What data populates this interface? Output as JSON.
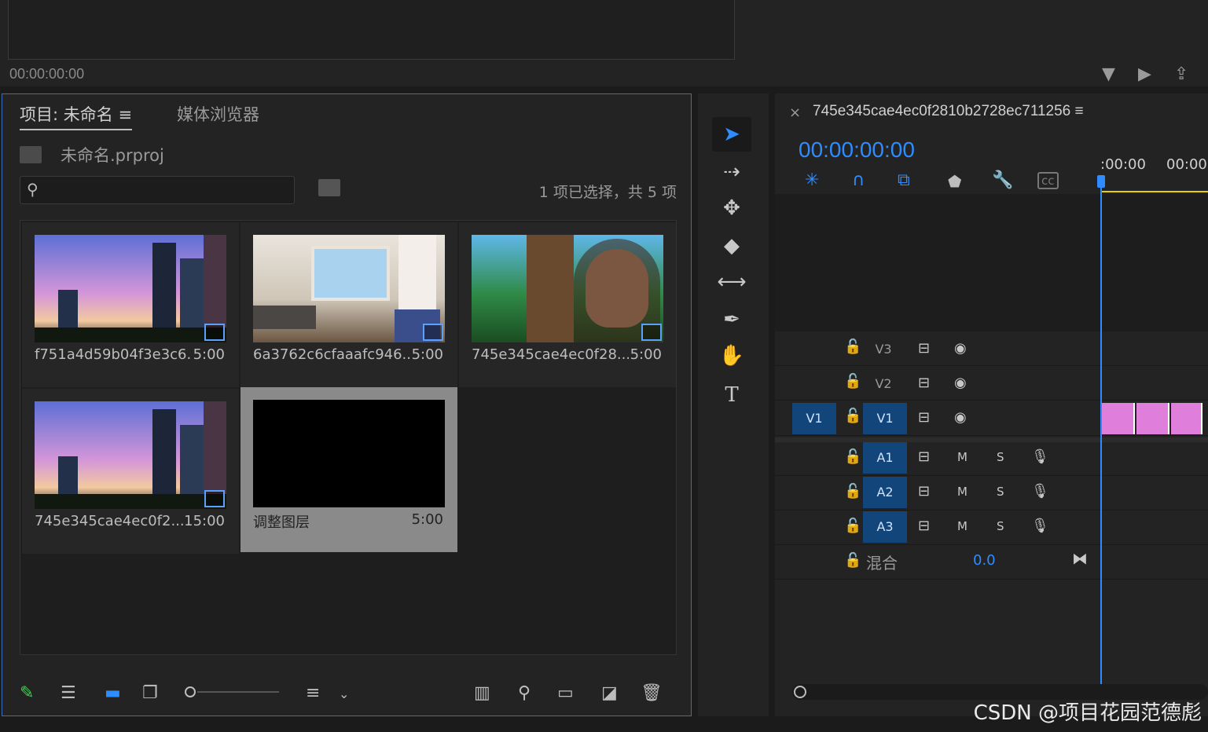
{
  "top": {
    "timecode": "00:00:00:00"
  },
  "project": {
    "tab_active": "项目: 未命名",
    "tab_inactive": "媒体浏览器",
    "file_name": "未命名.prproj",
    "search_placeholder": "",
    "selection_status": "1 项已选择，共 5 项",
    "items": [
      {
        "name": "f751a4d59b04f3e3c6...",
        "duration": "5:00",
        "selected": false
      },
      {
        "name": "6a3762c6cfaaafc946...",
        "duration": "5:00",
        "selected": false
      },
      {
        "name": "745e345cae4ec0f28...",
        "duration": "5:00",
        "selected": false
      },
      {
        "name": "745e345cae4ec0f2...",
        "duration": "15:00",
        "selected": false
      },
      {
        "name": "调整图层",
        "duration": "5:00",
        "selected": true
      }
    ]
  },
  "timeline": {
    "sequence_name": "745e345cae4ec0f2810b2728ec711256",
    "timecode": "00:00:00:00",
    "ruler_labels": [
      ":00:00",
      "00:00"
    ],
    "tracks": {
      "v3": "V3",
      "v2": "V2",
      "v1_src": "V1",
      "v1": "V1",
      "a1": "A1",
      "a2": "A2",
      "a3": "A3",
      "mute": "M",
      "solo": "S"
    },
    "mix_label": "混合",
    "mix_value": "0.0"
  },
  "watermark": "CSDN @项目花园范德彪",
  "colors": {
    "accent": "#2f8cff",
    "track_blue": "#12457a",
    "clip": "#e07fdb"
  }
}
